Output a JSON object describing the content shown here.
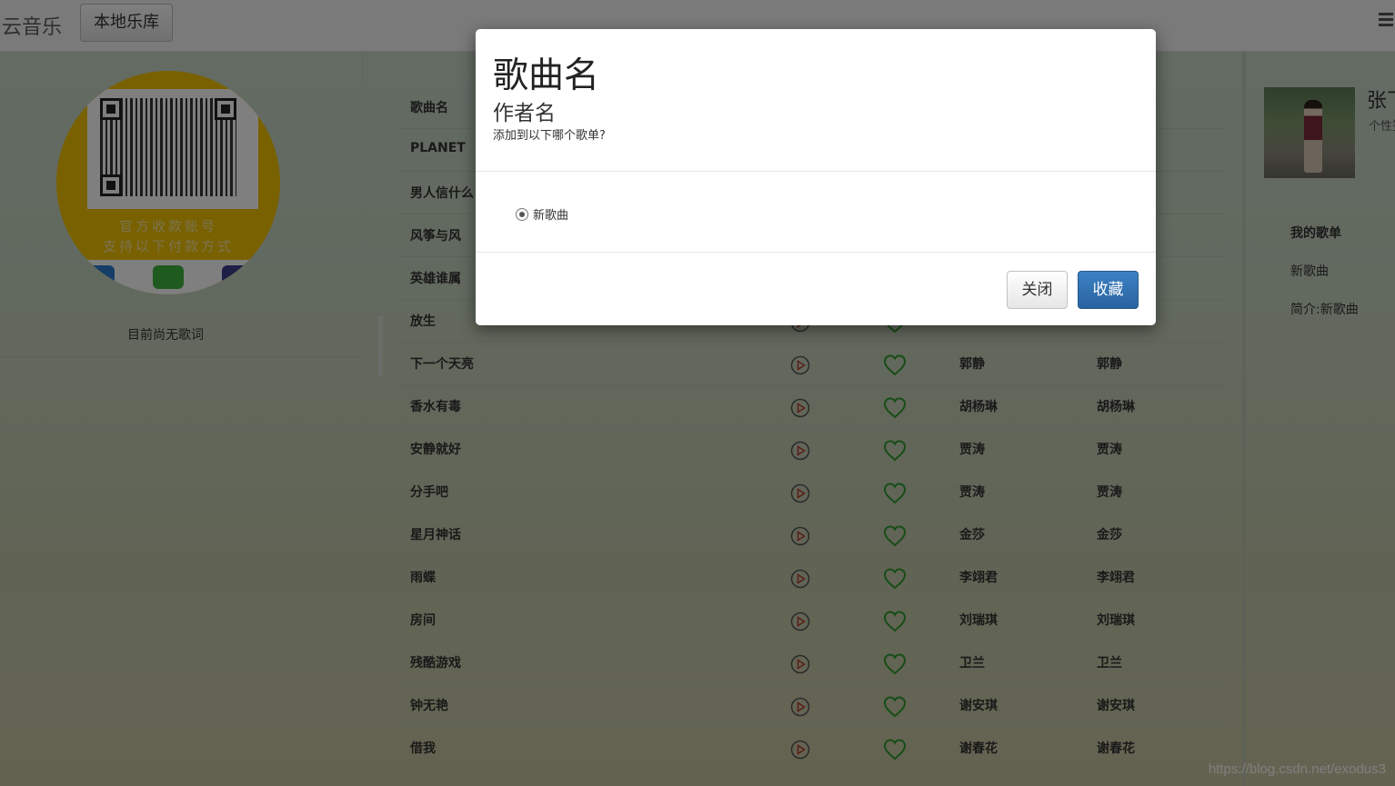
{
  "navbar": {
    "brand": "云音乐",
    "library_button": "本地乐库",
    "menu_icon": "list-icon"
  },
  "left_panel": {
    "qr_caption_1": "官方收款账号",
    "qr_caption_2": "支持以下付款方式",
    "lyrics_empty": "目前尚无歌词"
  },
  "table": {
    "header_name": "歌曲名",
    "rows": [
      {
        "name": "PLANET",
        "singer": "",
        "album": ""
      },
      {
        "name": "男人信什么",
        "singer": "",
        "album": ""
      },
      {
        "name": "风筝与风",
        "singer": "",
        "album": ""
      },
      {
        "name": "英雄谁属",
        "singer": "",
        "album": ""
      },
      {
        "name": "放生",
        "singer": "",
        "album": ""
      },
      {
        "name": "下一个天亮",
        "singer": "郭静",
        "album": "郭静"
      },
      {
        "name": "香水有毒",
        "singer": "胡杨琳",
        "album": "胡杨琳"
      },
      {
        "name": "安静就好",
        "singer": "贾涛",
        "album": "贾涛"
      },
      {
        "name": "分手吧",
        "singer": "贾涛",
        "album": "贾涛"
      },
      {
        "name": "星月神话",
        "singer": "金莎",
        "album": "金莎"
      },
      {
        "name": "雨蝶",
        "singer": "李翊君",
        "album": "李翊君"
      },
      {
        "name": "房间",
        "singer": "刘瑞琪",
        "album": "刘瑞琪"
      },
      {
        "name": "残酷游戏",
        "singer": "卫兰",
        "album": "卫兰"
      },
      {
        "name": "钟无艳",
        "singer": "谢安琪",
        "album": "谢安琪"
      },
      {
        "name": "借我",
        "singer": "谢春花",
        "album": "谢春花"
      }
    ]
  },
  "sidebar": {
    "profile_name": "张飞",
    "profile_signature": "个性签名",
    "my_playlists": "我的歌单",
    "playlist_name": "新歌曲",
    "playlist_desc": "简介:新歌曲"
  },
  "modal": {
    "title": "歌曲名",
    "subtitle": "作者名",
    "prompt": "添加到以下哪个歌单?",
    "option_label": "新歌曲",
    "close_label": "关闭",
    "collect_label": "收藏"
  },
  "watermark": "https://blog.csdn.net/exodus3",
  "colors": {
    "play_icon": "#b33a2e",
    "heart_icon": "#2e9a2e",
    "primary_button": "#2a62a0"
  }
}
